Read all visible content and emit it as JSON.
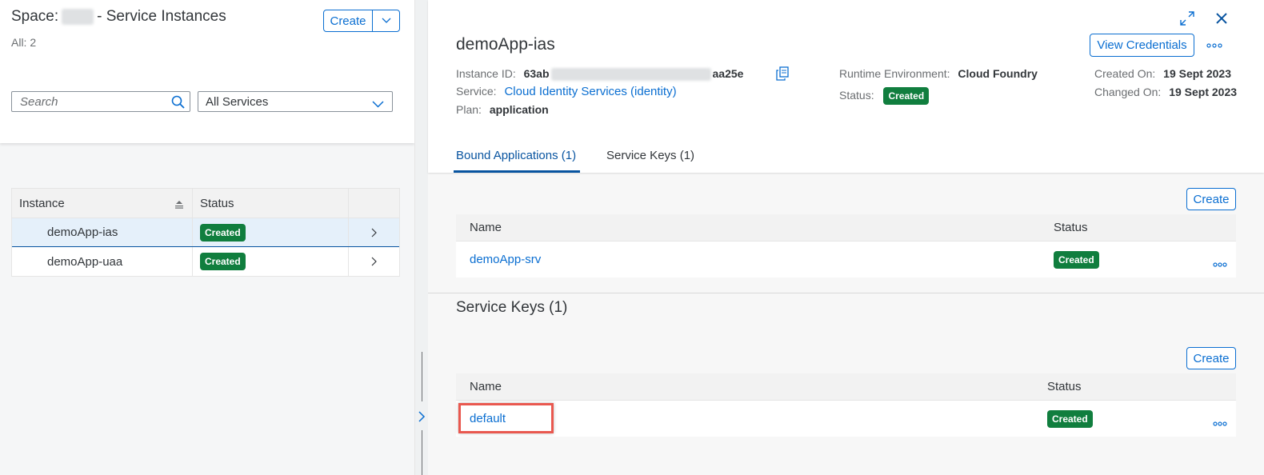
{
  "left": {
    "title_prefix": "Space:",
    "title_suffix": "- Service Instances",
    "count": "All: 2",
    "create_label": "Create",
    "search_placeholder": "Search",
    "filter_value": "All Services",
    "table": {
      "headers": [
        "Instance",
        "Status"
      ],
      "rows": [
        {
          "name": "demoApp-ias",
          "status": "Created",
          "selected": true
        },
        {
          "name": "demoApp-uaa",
          "status": "Created",
          "selected": false
        }
      ]
    }
  },
  "detail": {
    "title": "demoApp-ias",
    "view_credentials": "View Credentials",
    "instance_id_label": "Instance ID:",
    "instance_id_start": "63ab",
    "instance_id_end": "aa25e",
    "service_label": "Service:",
    "service_value": "Cloud Identity Services (identity)",
    "plan_label": "Plan:",
    "plan_value": "application",
    "runtime_label": "Runtime Environment:",
    "runtime_value": "Cloud Foundry",
    "status_label": "Status:",
    "status_value": "Created",
    "created_label": "Created On:",
    "created_value": "19 Sept 2023",
    "changed_label": "Changed On:",
    "changed_value": "19 Sept 2023",
    "tabs": [
      "Bound Applications (1)",
      "Service Keys (1)"
    ],
    "bound_apps": {
      "create_label": "Create",
      "headers": [
        "Name",
        "Status"
      ],
      "rows": [
        {
          "name": "demoApp-srv",
          "status": "Created"
        }
      ]
    },
    "service_keys": {
      "title": "Service Keys (1)",
      "create_label": "Create",
      "headers": [
        "Name",
        "Status"
      ],
      "rows": [
        {
          "name": "default",
          "status": "Created"
        }
      ]
    }
  },
  "colors": {
    "accent": "#0a6ed1",
    "success": "#107e3e",
    "highlight": "#e9584f"
  },
  "icons": [
    "chevron-down-icon",
    "search-icon",
    "sort-icon",
    "chevron-right-icon",
    "fullscreen-icon",
    "close-icon",
    "more-icon",
    "copy-icon"
  ]
}
